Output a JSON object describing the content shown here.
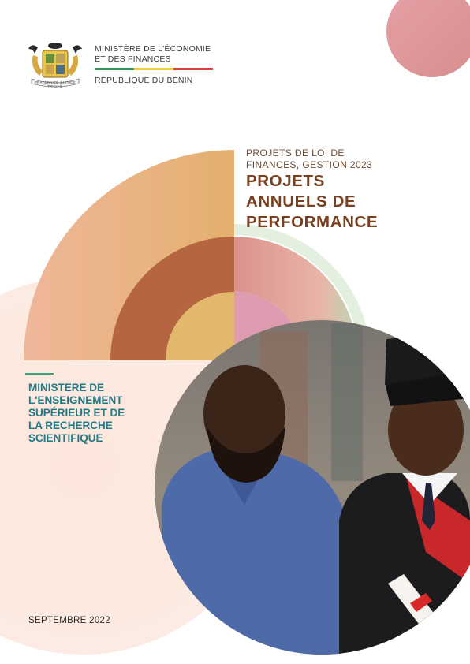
{
  "header": {
    "ministry_line1": "MINISTÈRE DE L'ÉCONOMIE",
    "ministry_line2": "ET DES FINANCES",
    "republic": "RÉPUBLIQUE DU BÉNIN",
    "flag_colors": [
      "#2e9a57",
      "#f3cf3a",
      "#e0403a"
    ],
    "emblem_motto": "FRATERNITÉ JUSTICE TRAVAIL"
  },
  "title": {
    "subtitle_line1": "PROJETS DE LOI DE",
    "subtitle_line2": "FINANCES, GESTION 2023",
    "main_line1": "PROJETS",
    "main_line2": "ANNUELS DE",
    "main_line3": "PERFORMANCE"
  },
  "ministry": {
    "line1": "MINISTERE DE",
    "line2": "L'ENSEIGNEMENT",
    "line3": "SUPÉRIEUR ET DE",
    "line4": "LA RECHERCHE",
    "line5": "SCIENTIFIQUE"
  },
  "date": "SEPTEMBRE 2022",
  "colors": {
    "title_brown": "#7a3f1f",
    "ministry_teal": "#217a86",
    "accent_green": "#3aa57a"
  }
}
